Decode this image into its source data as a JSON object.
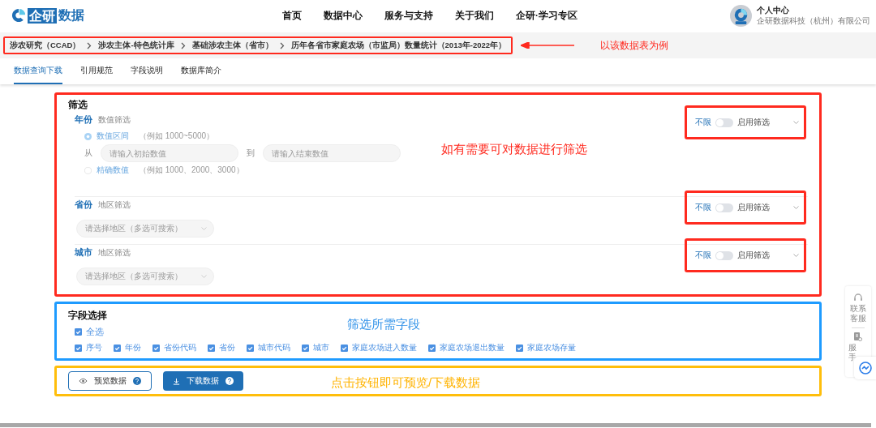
{
  "header": {
    "logo_mark": "企研",
    "logo_text": "数据",
    "nav": [
      "首页",
      "数据中心",
      "服务与支持",
      "关于我们",
      "企研·学习专区"
    ],
    "user": {
      "name": "个人中心",
      "company": "企研数据科技（杭州）有限公司"
    }
  },
  "breadcrumb": {
    "items": [
      "涉农研究（CCAD）",
      "涉农主体-特色统计库",
      "基础涉农主体（省市）",
      "历年各省市家庭农场（市监局）数量统计（2013年-2022年）"
    ],
    "annotation": "以该数据表为例"
  },
  "tabs": [
    {
      "label": "数据查询下载",
      "selected": true
    },
    {
      "label": "引用规范",
      "selected": false
    },
    {
      "label": "字段说明",
      "selected": false
    },
    {
      "label": "数据库简介",
      "selected": false
    }
  ],
  "filter": {
    "title": "筛选",
    "annotation": "如有需要可对数据进行筛选",
    "groups": [
      {
        "kind": "numeric",
        "label": "年份",
        "sublabel": "数值筛选",
        "switch_label": "不限",
        "switch_text": "启用筛选",
        "on": false,
        "options": [
          {
            "label": "数值区间",
            "hint": "（例如 1000~5000）",
            "selected": true
          },
          {
            "label": "精确数值",
            "hint": "（例如 1000、2000、3000）",
            "selected": false
          }
        ],
        "from_label": "从",
        "to_label": "到",
        "from_placeholder": "请输入初始数值",
        "to_placeholder": "请输入结束数值"
      },
      {
        "kind": "region",
        "label": "省份",
        "sublabel": "地区筛选",
        "switch_label": "不限",
        "switch_text": "启用筛选",
        "on": false,
        "placeholder": "请选择地区（多选可搜索）"
      },
      {
        "kind": "region",
        "label": "城市",
        "sublabel": "地区筛选",
        "switch_label": "不限",
        "switch_text": "启用筛选",
        "on": false,
        "placeholder": "请选择地区（多选可搜索）"
      }
    ]
  },
  "fields": {
    "title": "字段选择",
    "annotation": "筛选所需字段",
    "select_all": {
      "label": "全选",
      "checked": true
    },
    "items": [
      {
        "label": "序号",
        "checked": true
      },
      {
        "label": "年份",
        "checked": true
      },
      {
        "label": "省份代码",
        "checked": true
      },
      {
        "label": "省份",
        "checked": true
      },
      {
        "label": "城市代码",
        "checked": true
      },
      {
        "label": "城市",
        "checked": true
      },
      {
        "label": "家庭农场进入数量",
        "checked": true
      },
      {
        "label": "家庭农场退出数量",
        "checked": true
      },
      {
        "label": "家庭农场存量",
        "checked": true
      }
    ]
  },
  "actions": {
    "buttons": [
      {
        "kind": "outline",
        "label": "预览数据"
      },
      {
        "kind": "primary",
        "label": "下载数据"
      }
    ],
    "annotation": "点击按钮即可预览/下载数据"
  },
  "side": {
    "contact": "联系客服",
    "service": "服手"
  }
}
